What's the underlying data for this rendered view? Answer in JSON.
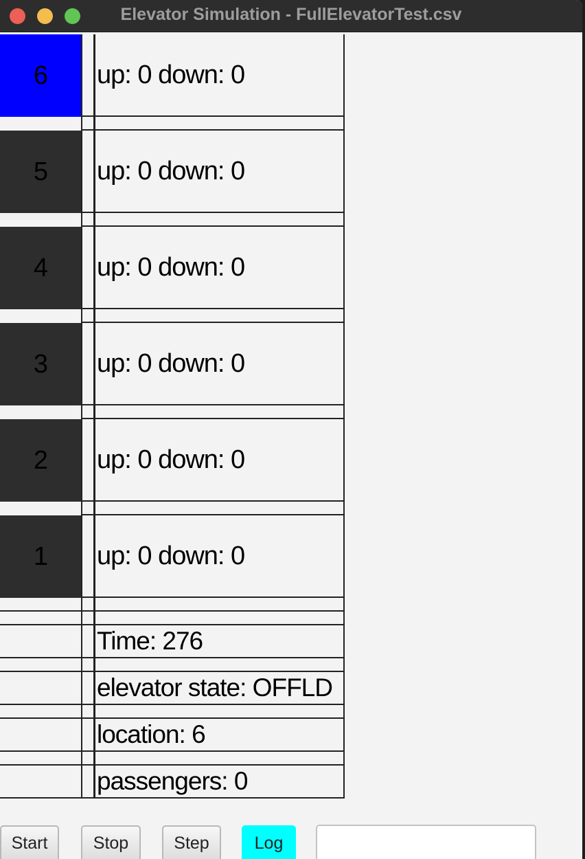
{
  "window": {
    "title": "Elevator Simulation - FullElevatorTest.csv"
  },
  "floors": [
    {
      "number": "6",
      "calls": "up: 0 down: 0",
      "active": true
    },
    {
      "number": "5",
      "calls": "up: 0 down: 0",
      "active": false
    },
    {
      "number": "4",
      "calls": "up: 0 down: 0",
      "active": false
    },
    {
      "number": "3",
      "calls": "up: 0 down: 0",
      "active": false
    },
    {
      "number": "2",
      "calls": "up: 0 down: 0",
      "active": false
    },
    {
      "number": "1",
      "calls": "up: 0 down: 0",
      "active": false
    }
  ],
  "status": {
    "time": "Time: 276",
    "state": "elevator state: OFFLD",
    "location": "location: 6",
    "passengers": "passengers: 0"
  },
  "controls": {
    "start_label": "Start",
    "stop_label": "Stop",
    "step_label": "Step",
    "log_label": "Log",
    "input_value": ""
  },
  "colors": {
    "active_floor": "#0000ff",
    "idle_floor": "#2d2d2d",
    "log_button": "#00ffff"
  }
}
